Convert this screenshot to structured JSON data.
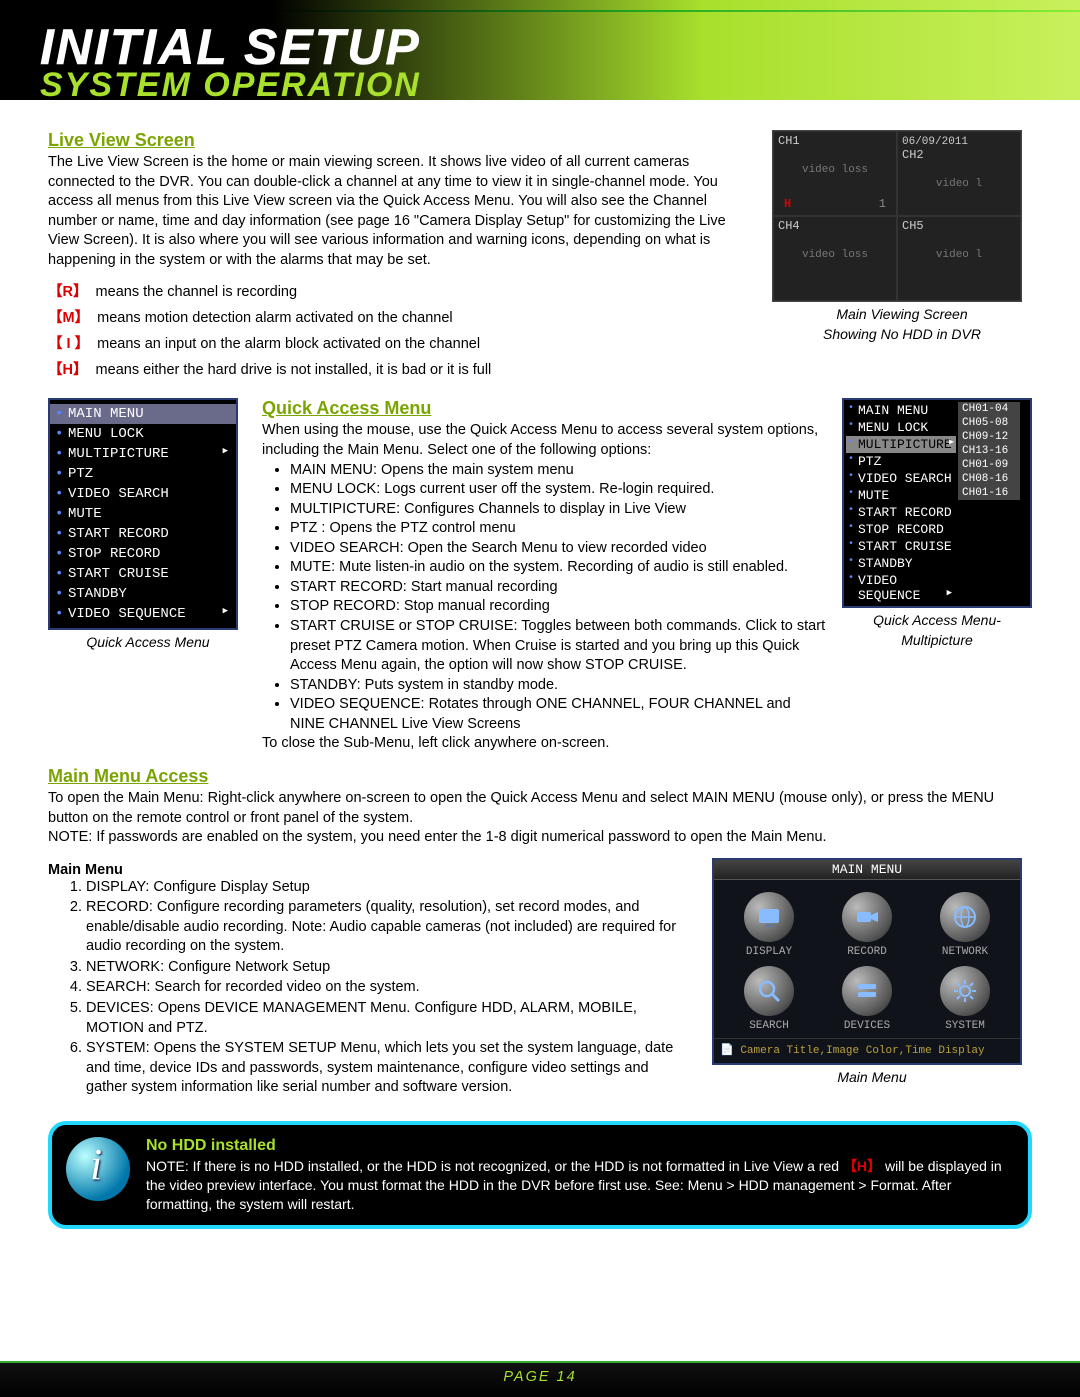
{
  "header": {
    "title_main": "INITIAL SETUP",
    "title_sub": "SYSTEM OPERATION"
  },
  "live": {
    "heading": "Live View Screen",
    "para": "The Live View Screen is the home or main viewing screen. It shows live video of all current cameras connected to the DVR. You can double-click a channel at any time to view it in single-channel mode. You access all menus from this Live View screen via the Quick Access Menu. You will also see the Channel number or name, time and day information (see page 16 \"Camera Display Setup\" for customizing the Live View Screen). It is also where you will see various information and warning icons, depending on what is happening in the system or with the alarms that may be set.",
    "legend": [
      {
        "sym": "【R】",
        "txt": "means the channel is recording"
      },
      {
        "sym": "【M】",
        "txt": "means motion detection alarm activated on the channel"
      },
      {
        "sym": "【 I 】",
        "txt": "means an input on the alarm block activated on the channel"
      },
      {
        "sym": "【H】",
        "txt": "means either the hard drive is not installed, it is bad or it is full"
      }
    ],
    "caption1": "Main Viewing Screen",
    "caption2": "Showing No HDD in DVR",
    "thumb": {
      "date": "06/09/2011",
      "ch1": "CH1",
      "ch2": "CH2",
      "ch4": "CH4",
      "ch5": "CH5",
      "loss": "video loss",
      "loss2": "video l",
      "h": "H",
      "one": "1"
    }
  },
  "quick": {
    "heading": "Quick Access Menu",
    "intro": "When using the mouse, use the Quick Access Menu to access several system options, including the Main Menu. Select one of the following options:",
    "bullets": [
      "MAIN MENU: Opens the main system menu",
      "MENU LOCK: Logs current user off the system. Re-login required.",
      "MULTIPICTURE: Configures Channels to display in Live View",
      "PTZ : Opens the PTZ control menu",
      "VIDEO SEARCH: Open the Search Menu to view recorded video",
      "MUTE: Mute listen-in audio on the system. Recording of audio is still enabled.",
      "START RECORD: Start manual recording",
      "STOP RECORD: Stop manual recording",
      "START CRUISE or STOP CRUISE: Toggles between both commands. Click to start preset PTZ Camera motion. When Cruise is started and you bring up this Quick Access Menu again, the option will now show STOP CRUISE.",
      "STANDBY: Puts system in standby mode.",
      "VIDEO SEQUENCE: Rotates through ONE CHANNEL, FOUR CHANNEL and NINE CHANNEL Live View Screens"
    ],
    "close": "To close the Sub-Menu, left click anywhere on-screen.",
    "cap_left": "Quick Access Menu",
    "cap_right1": "Quick Access Menu-",
    "cap_right2": "Multipicture",
    "menu_left": [
      "MAIN MENU",
      "MENU LOCK",
      "MULTIPICTURE",
      "PTZ",
      "VIDEO SEARCH",
      "MUTE",
      "START RECORD",
      "STOP RECORD",
      "START CRUISE",
      "STANDBY",
      "VIDEO SEQUENCE"
    ],
    "menu_right": [
      "MAIN MENU",
      "MENU LOCK",
      "MULTIPICTURE",
      "PTZ",
      "VIDEO SEARCH",
      "MUTE",
      "START RECORD",
      "STOP RECORD",
      "START CRUISE",
      "STANDBY",
      "VIDEO SEQUENCE"
    ],
    "menu_sub": [
      "CH01-04",
      "CH05-08",
      "CH09-12",
      "CH13-16",
      "CH01-09",
      "CH08-16",
      "CH01-16"
    ]
  },
  "main": {
    "heading": "Main Menu Access",
    "para1": "To open the Main Menu: Right-click anywhere on-screen to open the Quick Access Menu and select MAIN MENU (mouse only), or press the MENU button on the remote control or front panel of the system.",
    "para2": "NOTE: If passwords are enabled on the system, you need enter the 1-8 digit numerical password to open the Main Menu.",
    "subhead": "Main Menu",
    "items": [
      "DISPLAY: Configure Display Setup",
      "RECORD: Configure recording parameters (quality, resolution), set record modes, and enable/disable audio recording. Note: Audio capable cameras (not included) are required for audio recording on the system.",
      "NETWORK: Configure Network Setup",
      "SEARCH: Search for recorded video on the system.",
      "DEVICES: Opens DEVICE MANAGEMENT Menu. Configure HDD, ALARM, MOBILE, MOTION and PTZ.",
      "SYSTEM: Opens the SYSTEM SETUP Menu, which lets you set the system language, date and time, device IDs and passwords, system maintenance, configure video settings and gather system information like serial number and software version."
    ],
    "mm_title": "MAIN MENU",
    "mm_items": [
      "DISPLAY",
      "RECORD",
      "NETWORK",
      "SEARCH",
      "DEVICES",
      "SYSTEM"
    ],
    "mm_foot": "Camera Title,Image Color,Time Display",
    "cap": "Main Menu"
  },
  "note": {
    "title": "No HDD installed",
    "body1": "NOTE: If there is no HDD installed, or the HDD is not recognized, or the HDD is not formatted  in Live View a red ",
    "sym": "【H】",
    "body2": " will be displayed in the video preview interface. You must format the HDD in the DVR before first use. See: Menu > HDD management > Format. After formatting, the system will restart."
  },
  "footer": {
    "page": "PAGE 14"
  }
}
